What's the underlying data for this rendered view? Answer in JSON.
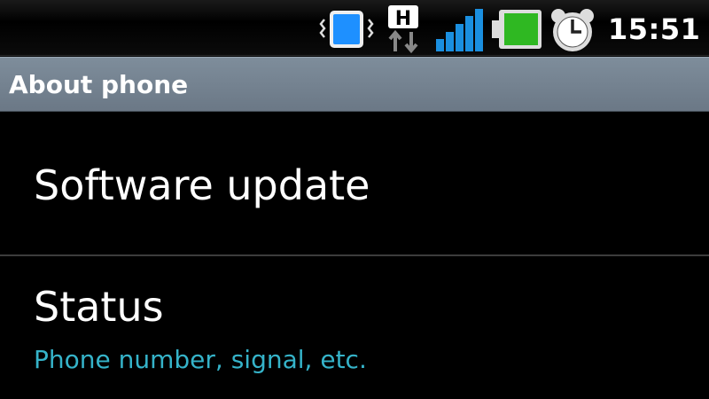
{
  "status_bar": {
    "time": "15:51",
    "network_type": "H",
    "icons": [
      "vibrate-icon",
      "hsdpa-icon",
      "signal-icon",
      "battery-icon",
      "alarm-icon"
    ],
    "signal_color": "#1a8fe0",
    "battery_color": "#2fb822"
  },
  "header": {
    "title": "About phone"
  },
  "list": {
    "items": [
      {
        "title": "Software update"
      },
      {
        "title": "Status",
        "summary": "Phone number, signal, etc."
      }
    ]
  },
  "colors": {
    "summary_text": "#35b3c9",
    "title_bar": "#7a8896",
    "background": "#000000"
  }
}
